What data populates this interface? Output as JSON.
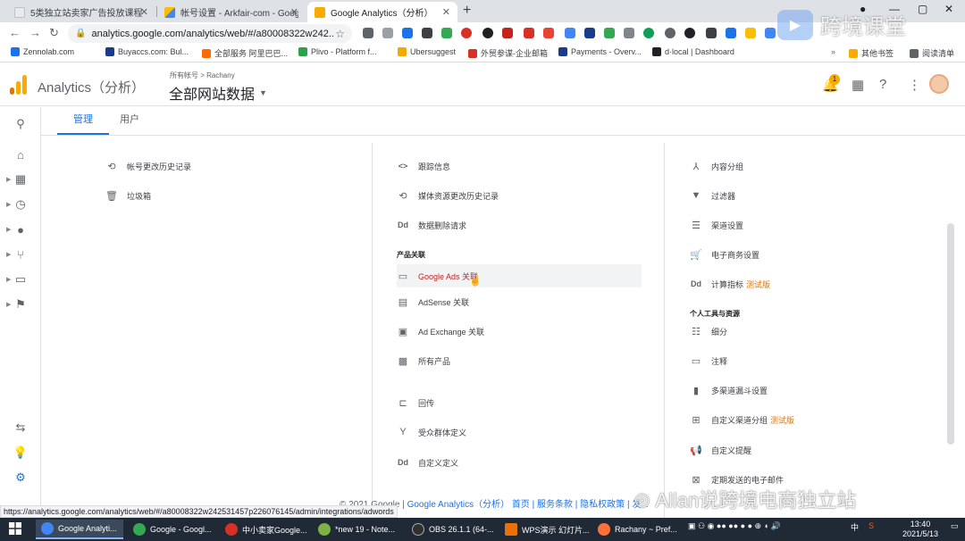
{
  "browser": {
    "tabs": [
      {
        "title": "5类独立站卖家广告投放课程",
        "icon_color": "#e8eaed"
      },
      {
        "title": "帐号设置 - Arkfair-com - Goog",
        "icon_color": "#4285f4"
      },
      {
        "title": "Google Analytics（分析）",
        "icon_color": "#f9ab00"
      }
    ],
    "new_tab_label": "+",
    "url": "analytics.google.com/analytics/web/#/a80008322w242..."
  },
  "bookmarks": [
    {
      "label": "Zennolab.com",
      "color": "#1a73e8"
    },
    {
      "label": "Buyaccs.com: Bul...",
      "color": "#1a3a8a"
    },
    {
      "label": "全部服务 阿里巴巴...",
      "color": "#ff6a00"
    },
    {
      "label": "Plivo - Platform f...",
      "color": "#2aa14a"
    },
    {
      "label": "Ubersuggest",
      "color": "#f2a900"
    },
    {
      "label": "外贸参谋-企业邮箱",
      "color": "#d93025"
    },
    {
      "label": "Payments - Overv...",
      "color": "#1a3a8a"
    },
    {
      "label": "d·local | Dashboard",
      "color": "#202124"
    },
    {
      "label": "其他书签",
      "color": "#f9ab00"
    },
    {
      "label": "阅读清单",
      "color": "#5f6368"
    }
  ],
  "header": {
    "app_title": "Analytics（分析）",
    "breadcrumb": "所有帐号 > Rachany",
    "view_name": "全部网站数据",
    "notification_count": "1"
  },
  "admin_tabs": [
    "管理",
    "用户"
  ],
  "columns": {
    "account": [
      {
        "icon": "history-icon",
        "glyph": "⟲",
        "label": "帐号更改历史记录"
      },
      {
        "icon": "trash-icon",
        "glyph": "🗑",
        "label": "垃圾箱"
      }
    ],
    "property": {
      "items_top": [
        {
          "icon": "code-icon",
          "glyph": "<>",
          "label": "跟踪信息"
        },
        {
          "icon": "history-icon",
          "glyph": "⟲",
          "label": "媒体资源更改历史记录"
        },
        {
          "icon": "data-deletion-icon",
          "glyph": "Dd",
          "label": "数据删除请求"
        }
      ],
      "section_label": "产品关联",
      "product_links": [
        {
          "icon": "google-ads-icon",
          "glyph": "▭",
          "label": "Google Ads 关联",
          "highlight": true
        },
        {
          "icon": "adsense-icon",
          "glyph": "▤",
          "label": "AdSense 关联"
        },
        {
          "icon": "ad-exchange-icon",
          "glyph": "▣",
          "label": "Ad Exchange 关联"
        },
        {
          "icon": "all-products-icon",
          "glyph": "▩",
          "label": "所有产品"
        }
      ],
      "items_bottom": [
        {
          "icon": "postback-icon",
          "glyph": "⊏",
          "label": "回传"
        },
        {
          "icon": "audience-icon",
          "glyph": "Y",
          "label": "受众群体定义"
        },
        {
          "icon": "custom-definitions-icon",
          "glyph": "Dd",
          "label": "自定义定义"
        }
      ]
    },
    "view": {
      "items_top": [
        {
          "icon": "content-grouping-icon",
          "glyph": "⅄",
          "label": "内容分组"
        },
        {
          "icon": "filter-icon",
          "glyph": "▼",
          "label": "过滤器"
        },
        {
          "icon": "channel-settings-icon",
          "glyph": "☰",
          "label": "渠道设置"
        },
        {
          "icon": "ecommerce-icon",
          "glyph": "🛒",
          "label": "电子商务设置"
        },
        {
          "icon": "calculated-metrics-icon",
          "glyph": "Dd",
          "label": "计算指标",
          "beta": "测试版"
        }
      ],
      "section_label": "个人工具与资源",
      "items_bottom": [
        {
          "icon": "segments-icon",
          "glyph": "☷",
          "label": "细分"
        },
        {
          "icon": "annotations-icon",
          "glyph": "▭",
          "label": "注释"
        },
        {
          "icon": "multi-channel-icon",
          "glyph": "▮",
          "label": "多渠道漏斗设置"
        },
        {
          "icon": "custom-channel-grouping-icon",
          "glyph": "⊞",
          "label": "自定义渠道分组",
          "beta": "测试版"
        },
        {
          "icon": "custom-alerts-icon",
          "glyph": "📢",
          "label": "自定义提醒"
        },
        {
          "icon": "scheduled-emails-icon",
          "glyph": "⊠",
          "label": "定期发送的电子邮件"
        }
      ]
    }
  },
  "footer": {
    "copyright": "© 2021 Google | ",
    "ga_link": "Google Analytics（分析）",
    "links": "首页 | 服务条款 | 隐私权政策 | 发..."
  },
  "status_url": "https://analytics.google.com/analytics/web/#/a80008322w242531457p226076145/admin/integrations/adwords",
  "watermark": {
    "bottom_text": "Allan说跨境电商独立站",
    "logo_text": "跨境课堂"
  },
  "taskbar": {
    "items": [
      {
        "label": "Google Analyti...",
        "color": "#4285f4",
        "active": true
      },
      {
        "label": "Google - Googl...",
        "color": "#34a853"
      },
      {
        "label": "中小卖家Google...",
        "color": "#d93025"
      },
      {
        "label": "*new 19 - Note...",
        "color": "#7cb342"
      },
      {
        "label": "OBS 26.1.1 (64-...",
        "color": "#303030"
      },
      {
        "label": "WPS演示 幻灯片...",
        "color": "#e8710a"
      },
      {
        "label": "Rachany ~ Pref...",
        "color": "#ff7139"
      }
    ],
    "time": "13:40",
    "date": "2021/5/13",
    "ime": "中"
  }
}
